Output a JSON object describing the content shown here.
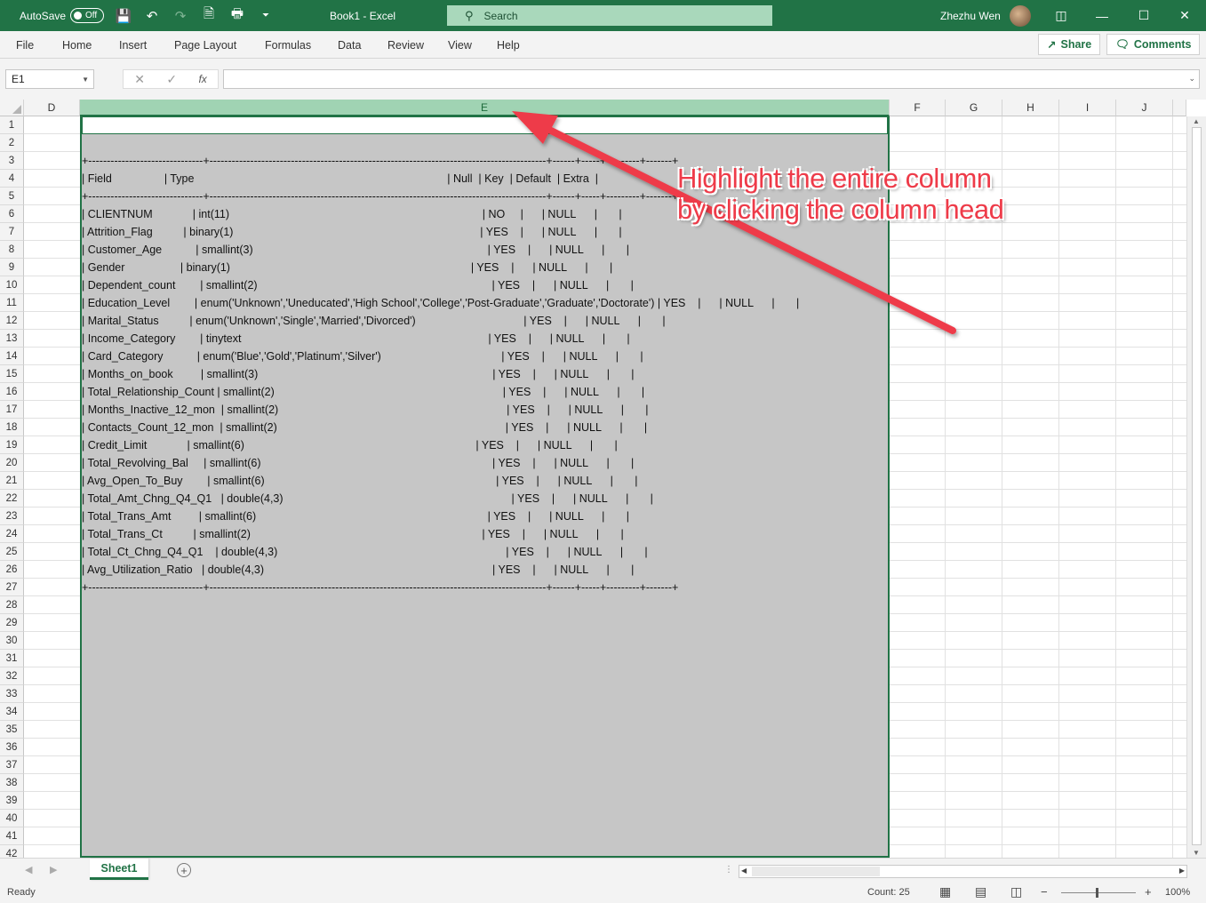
{
  "titlebar": {
    "autosave_label": "AutoSave",
    "autosave_state": "Off",
    "doc_title": "Book1  -  Excel",
    "search_placeholder": "Search",
    "user_name": "Zhezhu Wen"
  },
  "ribbon": {
    "tabs": [
      "File",
      "Home",
      "Insert",
      "Page Layout",
      "Formulas",
      "Data",
      "Review",
      "View",
      "Help"
    ],
    "share_label": "Share",
    "comments_label": "Comments"
  },
  "formula_bar": {
    "name_box": "E1",
    "fx_label": "fx",
    "formula": ""
  },
  "grid": {
    "columns": [
      "D",
      "E",
      "F",
      "G",
      "H",
      "I",
      "J"
    ],
    "selected_column": "E",
    "row_numbers": [
      "1",
      "2",
      "3",
      "4",
      "5",
      "6",
      "7",
      "8",
      "9",
      "10",
      "11",
      "12",
      "13",
      "14",
      "15",
      "16",
      "17",
      "18",
      "19",
      "20",
      "21",
      "22",
      "23",
      "24",
      "25",
      "26",
      "27",
      "28",
      "29",
      "30",
      "31",
      "32",
      "33",
      "34",
      "35",
      "36",
      "37",
      "38",
      "39",
      "40",
      "41",
      "42"
    ],
    "column_e_cells": [
      "",
      "",
      "+-------------------------------+-------------------------------------------------------------------------------------------+------+-----+---------+-------+",
      "| Field                 | Type                                                                                  | Null  | Key  | Default  | Extra  |",
      "+-------------------------------+-------------------------------------------------------------------------------------------+------+-----+---------+-------+",
      "| CLIENTNUM             | int(11)                                                                                  | NO     |      | NULL      |       |",
      "| Attrition_Flag          | binary(1)                                                                                | YES    |      | NULL      |       |",
      "| Customer_Age           | smallint(3)                                                                            | YES    |      | NULL      |       |",
      "| Gender                  | binary(1)                                                                              | YES    |      | NULL      |       |",
      "| Dependent_count        | smallint(2)                                                                            | YES    |      | NULL      |       |",
      "| Education_Level        | enum('Unknown','Uneducated','High School','College','Post-Graduate','Graduate','Doctorate') | YES    |      | NULL      |       |",
      "| Marital_Status          | enum('Unknown','Single','Married','Divorced')                                   | YES    |      | NULL      |       |",
      "| Income_Category        | tinytext                                                                                | YES    |      | NULL      |       |",
      "| Card_Category           | enum('Blue','Gold','Platinum','Silver')                                       | YES    |      | NULL      |       |",
      "| Months_on_book         | smallint(3)                                                                            | YES    |      | NULL      |       |",
      "| Total_Relationship_Count | smallint(2)                                                                          | YES    |      | NULL      |       |",
      "| Months_Inactive_12_mon  | smallint(2)                                                                          | YES    |      | NULL      |       |",
      "| Contacts_Count_12_mon  | smallint(2)                                                                          | YES    |      | NULL      |       |",
      "| Credit_Limit             | smallint(6)                                                                           | YES    |      | NULL      |       |",
      "| Total_Revolving_Bal     | smallint(6)                                                                           | YES    |      | NULL      |       |",
      "| Avg_Open_To_Buy        | smallint(6)                                                                           | YES    |      | NULL      |       |",
      "| Total_Amt_Chng_Q4_Q1   | double(4,3)                                                                          | YES    |      | NULL      |       |",
      "| Total_Trans_Amt         | smallint(6)                                                                           | YES    |      | NULL      |       |",
      "| Total_Trans_Ct          | smallint(2)                                                                           | YES    |      | NULL      |       |",
      "| Total_Ct_Chng_Q4_Q1    | double(4,3)                                                                          | YES    |      | NULL      |       |",
      "| Avg_Utilization_Ratio   | double(4,3)                                                                          | YES    |      | NULL      |       |",
      "+-------------------------------+-------------------------------------------------------------------------------------------+------+-----+---------+-------+"
    ]
  },
  "annotation": {
    "line1": "Highlight the entire column",
    "line2": "by clicking the column head",
    "color": "#ee3b49"
  },
  "sheet_tabs": {
    "tabs": [
      "Sheet1"
    ],
    "add_label": "+"
  },
  "status_bar": {
    "status": "Ready",
    "count": "Count: 25",
    "zoom": "100%",
    "minus": "−",
    "plus": "+"
  },
  "colors": {
    "excel_green": "#217346",
    "selected_header": "#a0d3b3",
    "selection_fill": "#c6c6c6"
  }
}
